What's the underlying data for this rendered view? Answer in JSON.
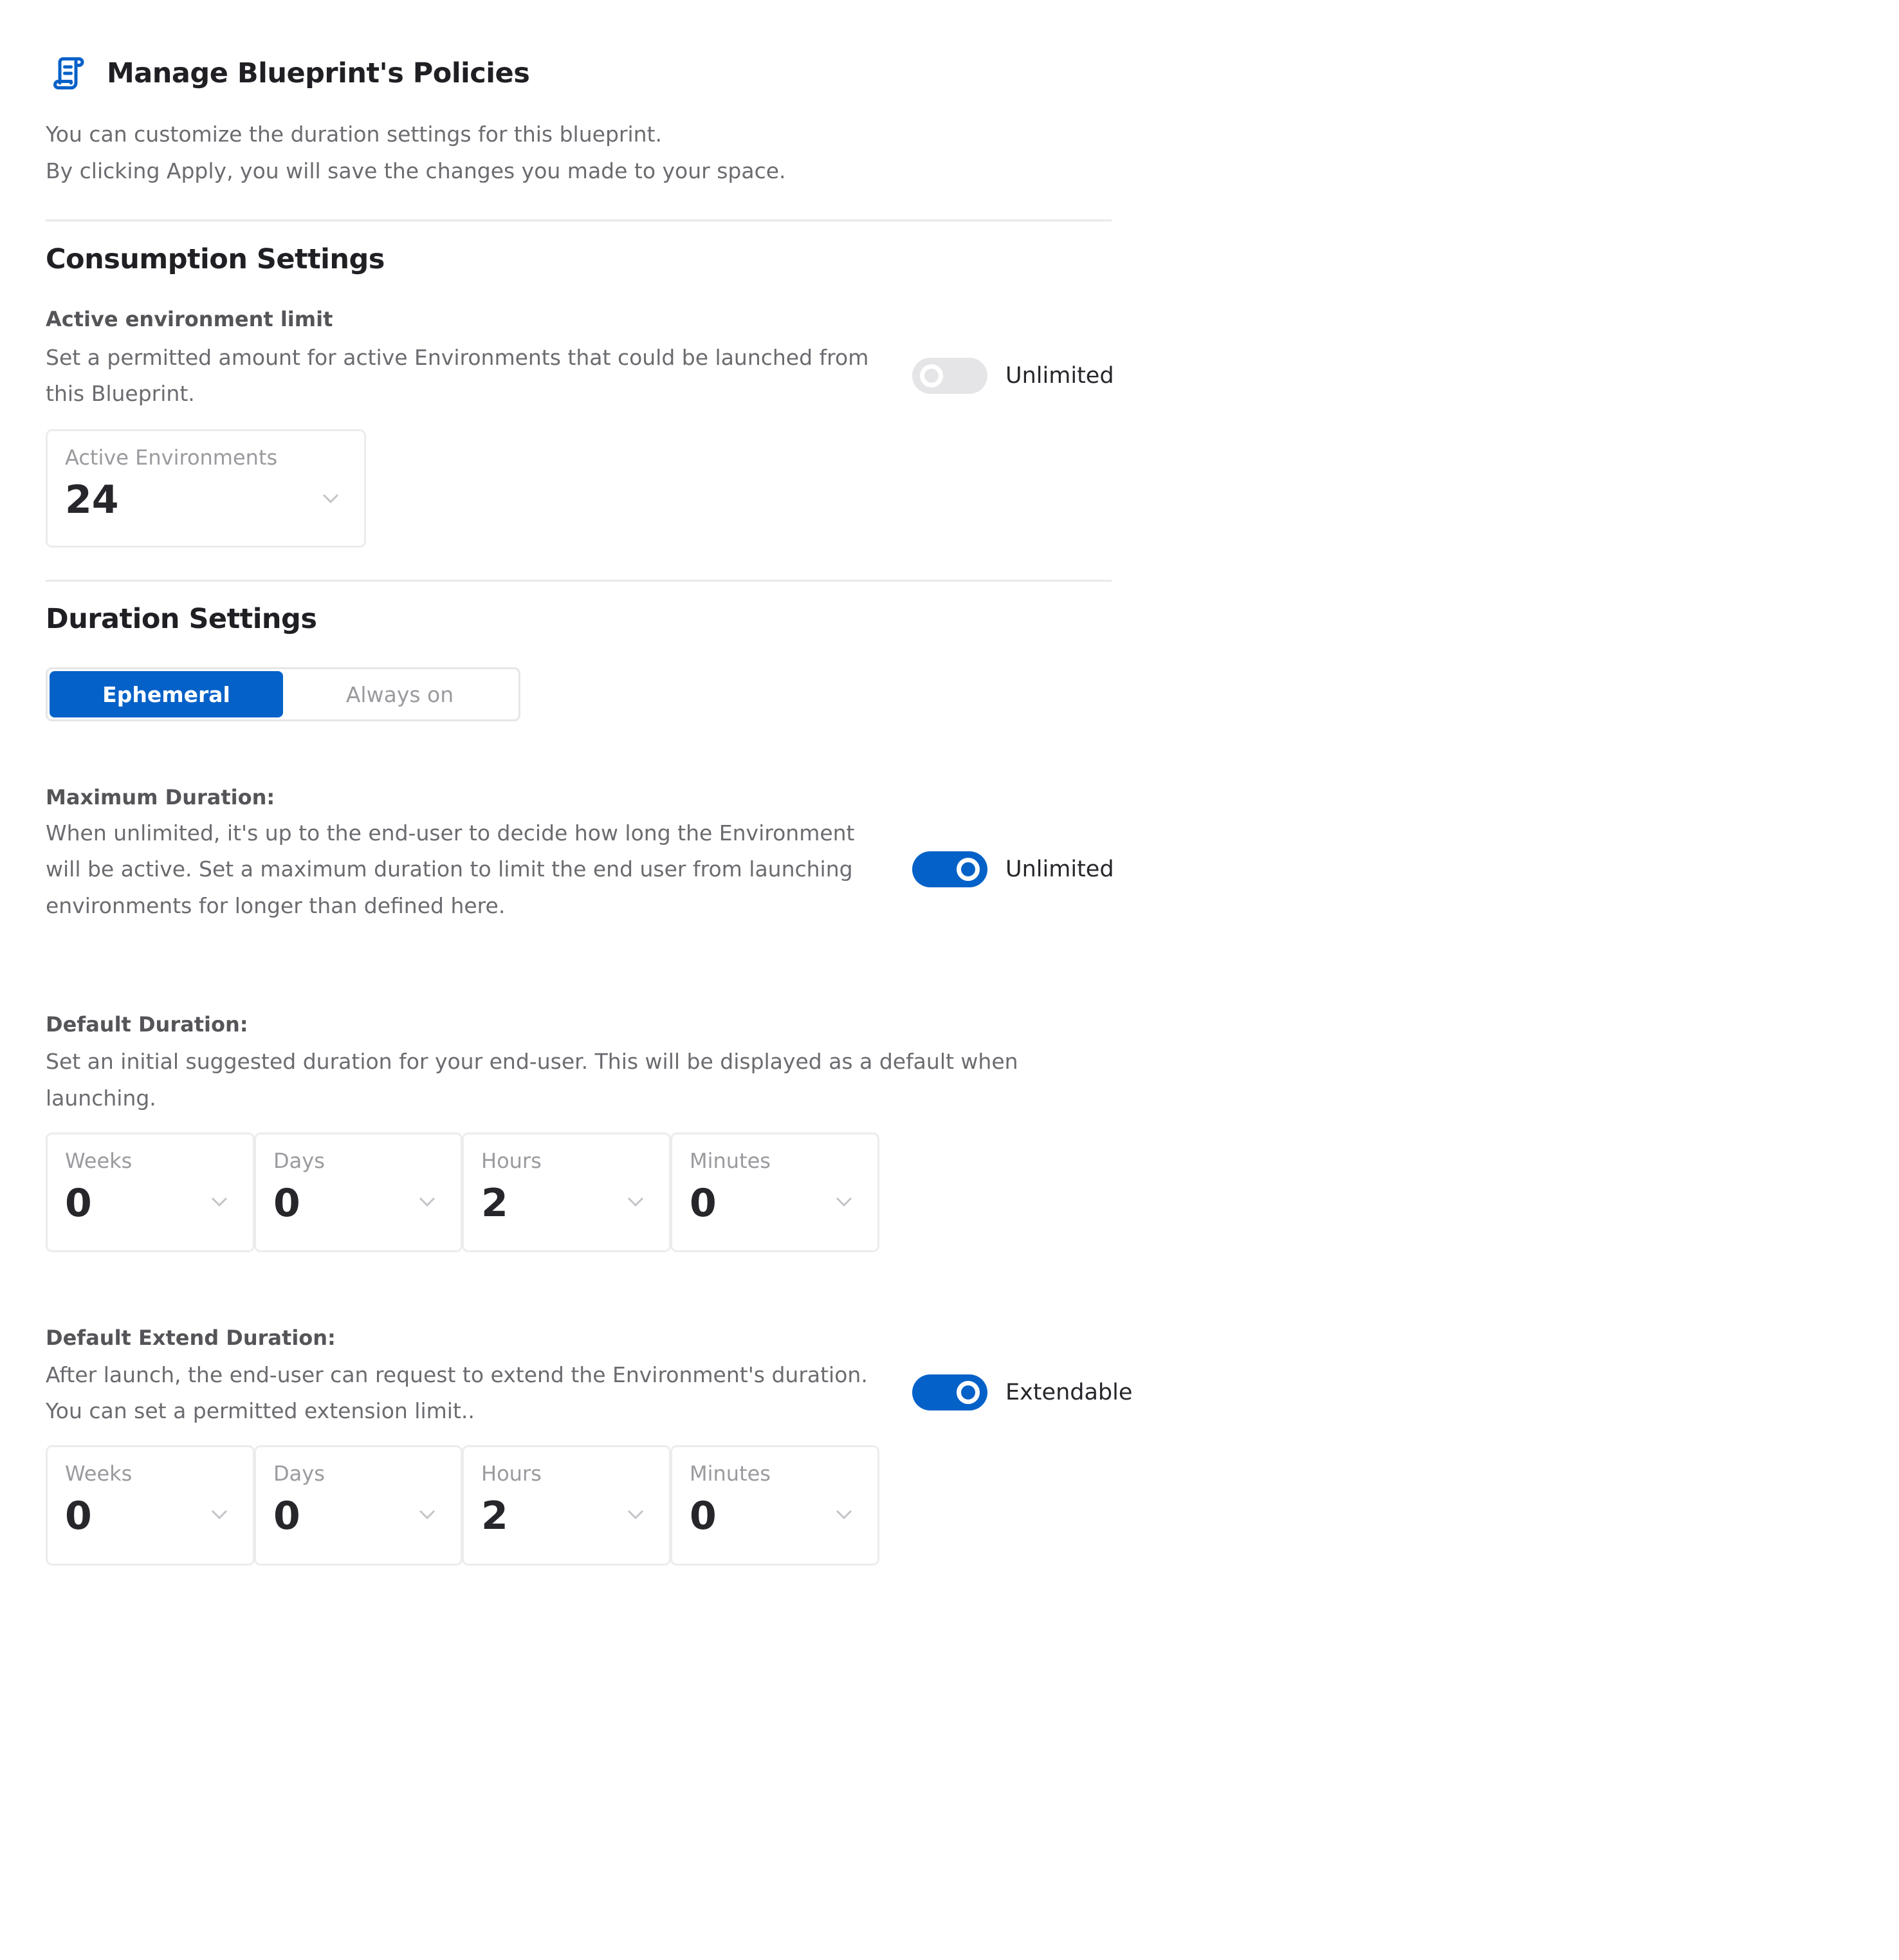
{
  "header": {
    "icon": "scroll-document-icon",
    "title": "Manage Blueprint's Policies",
    "description_lines": [
      "You can customize the duration settings for this blueprint.",
      "By clicking Apply, you will save the changes you made to your space."
    ]
  },
  "consumption": {
    "title": "Consumption Settings",
    "active_limit": {
      "label": "Active environment limit",
      "description_lines": [
        "Set a permitted amount for active Environments that could be launched from",
        "this Blueprint."
      ],
      "toggle_label": "Unlimited",
      "toggle_on": false,
      "select_label": "Active Environments",
      "select_value": "24"
    }
  },
  "duration": {
    "title": "Duration Settings",
    "modes": [
      {
        "label": "Ephemeral",
        "active": true
      },
      {
        "label": "Always on",
        "active": false
      }
    ],
    "maximum": {
      "label": "Maximum Duration:",
      "description_lines": [
        "When unlimited, it's up to the end-user to decide how long the Environment",
        "will be active. Set a maximum duration to limit the end user from launching",
        "environments for longer than defined here."
      ],
      "toggle_label": "Unlimited",
      "toggle_on": true
    },
    "default": {
      "label": "Default Duration:",
      "description_lines": [
        "Set an initial suggested duration for your end-user. This will be displayed as a default when",
        "launching."
      ],
      "fields": [
        {
          "label": "Weeks",
          "value": "0"
        },
        {
          "label": "Days",
          "value": "0"
        },
        {
          "label": "Hours",
          "value": "2"
        },
        {
          "label": "Minutes",
          "value": "0"
        }
      ]
    },
    "extend": {
      "label": "Default Extend Duration:",
      "description_lines": [
        "After launch, the end-user can request to extend the Environment's duration.",
        "You can set a permitted extension limit.."
      ],
      "toggle_label": "Extendable",
      "toggle_on": true,
      "fields": [
        {
          "label": "Weeks",
          "value": "0"
        },
        {
          "label": "Days",
          "value": "0"
        },
        {
          "label": "Hours",
          "value": "2"
        },
        {
          "label": "Minutes",
          "value": "0"
        }
      ]
    }
  },
  "colors": {
    "accent": "#0461c8",
    "toggle_off": "#e5e5e8",
    "divider": "#e9e9eb"
  }
}
